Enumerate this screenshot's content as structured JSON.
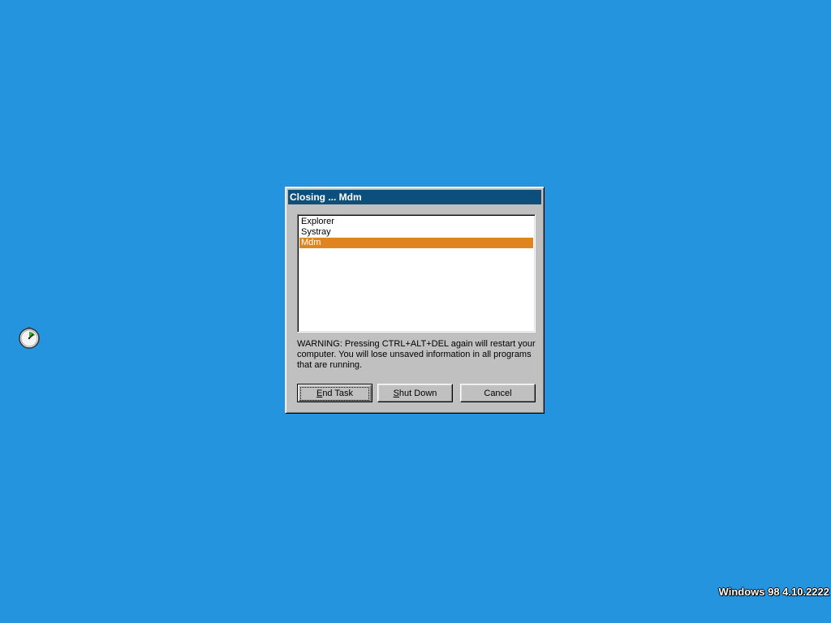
{
  "colors": {
    "desktop": "#2394dd",
    "titlebar": "#0d4f7b",
    "selection": "#e0841f"
  },
  "desktop": {
    "icon": "clock-icon",
    "version_text": "Windows 98 4.10.2222"
  },
  "dialog": {
    "title": "Closing ... Mdm",
    "tasks": [
      {
        "label": "Explorer",
        "selected": false
      },
      {
        "label": "Systray",
        "selected": false
      },
      {
        "label": "Mdm",
        "selected": true
      }
    ],
    "warning": "WARNING: Pressing CTRL+ALT+DEL again will restart your computer. You will lose unsaved information in all programs that are running.",
    "buttons": {
      "end_task": {
        "pre": "",
        "mnemonic": "E",
        "post": "nd Task"
      },
      "shut_down": {
        "pre": "",
        "mnemonic": "S",
        "post": "hut Down"
      },
      "cancel": "Cancel"
    }
  }
}
